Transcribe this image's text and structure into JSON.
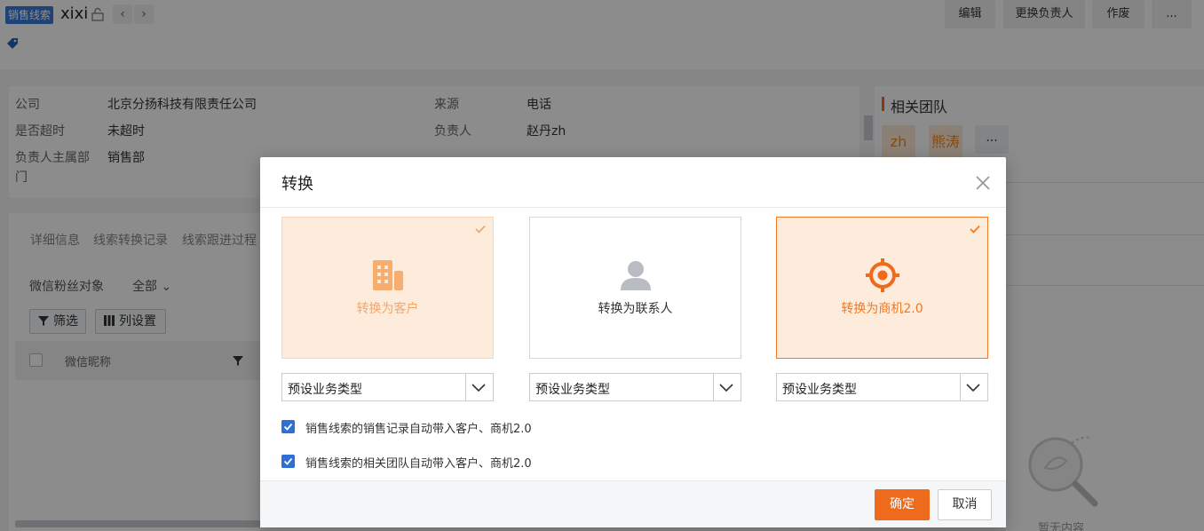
{
  "header": {
    "object_tag": "销售线索",
    "record_title": "xixi",
    "prev_icon": "chevron-left-icon",
    "next_icon": "chevron-right-icon",
    "buttons": [
      "编辑",
      "更换负责人",
      "作废",
      "..."
    ]
  },
  "info": {
    "fields": [
      {
        "label": "公司",
        "value": "北京分扬科技有限责任公司"
      },
      {
        "label": "是否超时",
        "value": "未超时"
      },
      {
        "label": "负责人主属部门",
        "value": "销售部"
      },
      {
        "label": "来源",
        "value": "电话"
      },
      {
        "label": "负责人",
        "value": "赵丹zh"
      }
    ],
    "dept_label_line1": "负责人主属部",
    "dept_label_line2": "门"
  },
  "team": {
    "title": "相关团队",
    "members": [
      "zh",
      "熊涛"
    ],
    "more": "..."
  },
  "detail_tabs": {
    "tabs": [
      "详细信息",
      "线索转换记录",
      "线索跟进过程"
    ],
    "filter_label": "微信粉丝对象",
    "filter_value": "全部",
    "filter_button": "筛选",
    "columns_button": "列设置",
    "column_header": "微信昵称"
  },
  "empty_state": {
    "text": "暂无内容"
  },
  "modal": {
    "title": "转换",
    "options": [
      {
        "label": "转换为客户",
        "icon": "building-icon",
        "state": "selected-light"
      },
      {
        "label": "转换为联系人",
        "icon": "person-icon",
        "state": "unselected"
      },
      {
        "label": "转换为商机2.0",
        "icon": "target-icon",
        "state": "selected"
      }
    ],
    "selects": [
      "预设业务类型",
      "预设业务类型",
      "预设业务类型"
    ],
    "checkboxes": [
      {
        "label": "销售线索的销售记录自动带入客户、商机2.0",
        "checked": true
      },
      {
        "label": "销售线索的相关团队自动带入客户、商机2.0",
        "checked": true
      }
    ],
    "confirm": "确定",
    "cancel": "取消"
  },
  "colors": {
    "accent": "#ee6a1c",
    "checkbox": "#2d6fd3",
    "selected_bg": "#fdebdc"
  }
}
